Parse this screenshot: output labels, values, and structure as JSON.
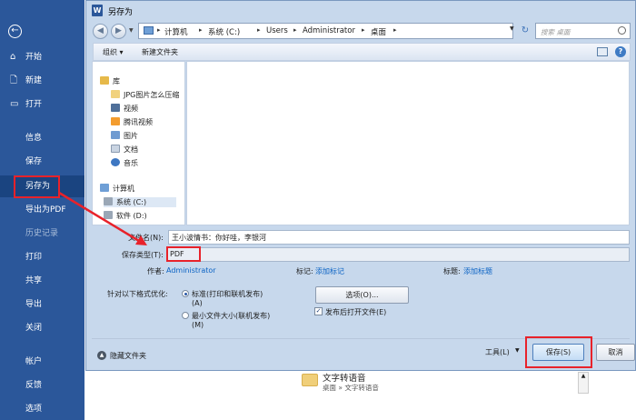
{
  "backstage": {
    "back_icon": "←",
    "items": [
      {
        "label": "开始",
        "icon": "home-icon",
        "glyph": "⌂"
      },
      {
        "label": "新建",
        "icon": "new-document-icon",
        "glyph": "🗋"
      },
      {
        "label": "打开",
        "icon": "open-folder-icon",
        "glyph": "▭"
      },
      {
        "label": "信息"
      },
      {
        "label": "保存"
      },
      {
        "label": "另存为"
      },
      {
        "label": "导出为PDF"
      },
      {
        "label": "历史记录"
      },
      {
        "label": "打印"
      },
      {
        "label": "共享"
      },
      {
        "label": "导出"
      },
      {
        "label": "关闭"
      },
      {
        "label": "帐户"
      },
      {
        "label": "反馈"
      },
      {
        "label": "选项"
      }
    ]
  },
  "dialog": {
    "title": "另存为",
    "address": {
      "crumbs": [
        "计算机",
        "系统 (C:)",
        "Users",
        "Administrator",
        "桌面"
      ]
    },
    "search_placeholder": "搜索 桌面",
    "toolbar": {
      "organize": "组织 ▾",
      "new_folder": "新建文件夹"
    },
    "tree": [
      {
        "label": "库",
        "icon": "library-icon",
        "color": "#e6b94a"
      },
      {
        "label": "JPG图片怎么压缩",
        "icon": "folder-icon",
        "color": "#f1d27e"
      },
      {
        "label": "视频",
        "icon": "videos-icon",
        "color": "#4f6f99"
      },
      {
        "label": "腾讯视频",
        "icon": "tencent-video-icon",
        "color": "#f39c2e"
      },
      {
        "label": "图片",
        "icon": "pictures-icon",
        "color": "#6f9bd1"
      },
      {
        "label": "文档",
        "icon": "documents-icon",
        "color": "#c9d4e2"
      },
      {
        "label": "音乐",
        "icon": "music-icon",
        "color": "#3e77c2"
      },
      {
        "label": "计算机",
        "icon": "computer-icon",
        "color": "#6f9fd6"
      },
      {
        "label": "系统 (C:)",
        "icon": "drive-icon",
        "color": "#9aa7b6"
      },
      {
        "label": "软件 (D:)",
        "icon": "drive-icon",
        "color": "#9aa7b6"
      }
    ],
    "filename_label": "文件名(N):",
    "filename_value": "王小波情书：你好哇，李银河",
    "filetype_label": "保存类型(T):",
    "filetype_value": "PDF",
    "author_label": "作者:",
    "author_value": "Administrator",
    "tags_label": "标记:",
    "tags_value": "添加标记",
    "title_label": "标题:",
    "title_value": "添加标题",
    "optimize_label": "针对以下格式优化:",
    "opt_standard": "标准(打印和联机发布)",
    "opt_standard_key": "(A)",
    "opt_minimum": "最小文件大小(联机发布)",
    "opt_minimum_key": "(M)",
    "options_button": "选项(O)...",
    "open_after": "发布后打开文件(E)",
    "hide_folders": "隐藏文件夹",
    "tools": "工具(L)",
    "save": "保存(S)",
    "cancel": "取消"
  },
  "background": {
    "file_name": "文字转语音",
    "file_path": "桌面 » 文字转语音"
  },
  "colors": {
    "backstage": "#2b579a",
    "highlight": "#e8222a",
    "link": "#0b63c4",
    "dialog": "#c7d8ec"
  }
}
